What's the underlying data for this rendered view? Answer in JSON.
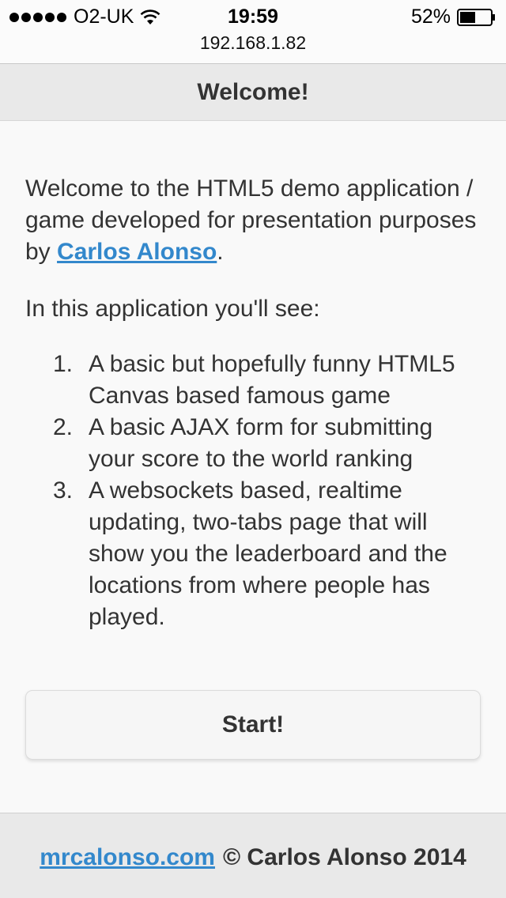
{
  "status_bar": {
    "carrier": "O2-UK",
    "time": "19:59",
    "battery_percent": "52%",
    "battery_level": 0.52,
    "signal_bars": 5
  },
  "browser": {
    "url": "192.168.1.82"
  },
  "header": {
    "title": "Welcome!"
  },
  "content": {
    "intro_text": "Welcome to the HTML5 demo application / game developed for presentation purposes by ",
    "author_link": "Carlos Alonso",
    "intro_end": ".",
    "list_intro": "In this application you'll see:",
    "features": [
      {
        "num": "1.",
        "text": "A basic but hopefully funny HTML5 Canvas based famous game"
      },
      {
        "num": "2.",
        "text": "A basic AJAX form for submitting your score to the world ranking"
      },
      {
        "num": "3.",
        "text": "A websockets based, realtime updating, two-tabs page that will show you the leaderboard and the locations from where people has played."
      }
    ]
  },
  "start_button": {
    "label": "Start!"
  },
  "footer": {
    "site_link": "mrcalonso.com",
    "copyright": "© Carlos Alonso 2014"
  },
  "colors": {
    "link": "#3388cc",
    "header_bg": "#e9e9e9",
    "page_bg": "#f9f9f9"
  }
}
